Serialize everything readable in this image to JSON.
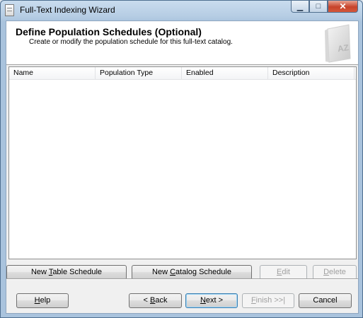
{
  "window": {
    "title": "Full-Text Indexing Wizard"
  },
  "header": {
    "title": "Define Population Schedules (Optional)",
    "subtitle": "Create or modify the population schedule for this full-text catalog.",
    "icon_text": "AZ"
  },
  "table": {
    "columns": [
      "Name",
      "Population Type",
      "Enabled",
      "Description"
    ],
    "rows": []
  },
  "actions": {
    "new_table_schedule": {
      "prefix": "New ",
      "accel": "T",
      "suffix": "able Schedule"
    },
    "new_catalog_schedule": {
      "prefix": "New ",
      "accel": "C",
      "suffix": "atalog Schedule"
    },
    "edit": {
      "prefix": "",
      "accel": "E",
      "suffix": "dit"
    },
    "delete": {
      "prefix": "",
      "accel": "D",
      "suffix": "elete"
    }
  },
  "footer": {
    "help": {
      "prefix": "",
      "accel": "H",
      "suffix": "elp"
    },
    "back": {
      "prefix": "< ",
      "accel": "B",
      "suffix": "ack"
    },
    "next": {
      "prefix": "",
      "accel": "N",
      "suffix": "ext >"
    },
    "finish": {
      "prefix": "",
      "accel": "F",
      "suffix": "inish >>|"
    },
    "cancel": {
      "prefix": "Cancel",
      "accel": "",
      "suffix": ""
    }
  }
}
